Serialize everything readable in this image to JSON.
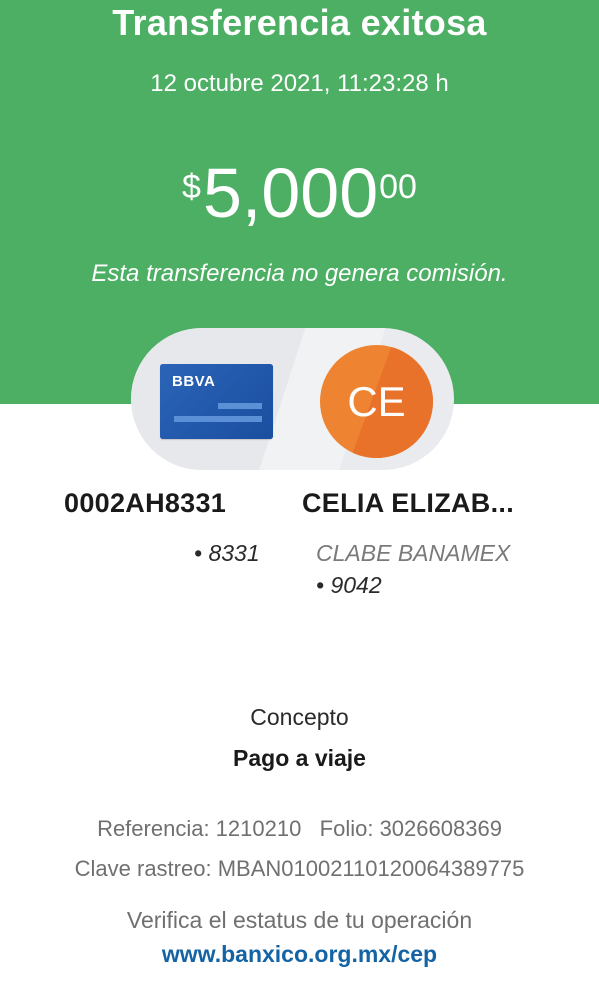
{
  "header": {
    "title": "Transferencia exitosa",
    "datetime": "12 octubre 2021, 11:23:28 h",
    "amount": {
      "currency": "$",
      "integer": "5,000",
      "decimals": "00"
    },
    "fee_note": "Esta transferencia no genera comisión."
  },
  "origin": {
    "card_logo": "BBVA",
    "account": "0002AH8331",
    "masked": "• 8331"
  },
  "destination": {
    "initials": "CE",
    "name": "CELIA ELIZAB...",
    "bank": "CLABE BANAMEX",
    "masked": "• 9042"
  },
  "concept": {
    "label": "Concepto",
    "value": "Pago a viaje"
  },
  "details": {
    "reference_line": "Referencia: 1210210   Folio: 3026608369",
    "tracking_line": "Clave rastreo: MBAN01002110120064389775"
  },
  "footer": {
    "verify_text": "Verifica el estatus de tu operación",
    "link_text": "www.banxico.org.mx/cep"
  },
  "colors": {
    "header_green": "#4caf64",
    "card_blue": "#1b4fa0",
    "avatar_orange": "#ee8432",
    "link_blue": "#1464a5"
  }
}
